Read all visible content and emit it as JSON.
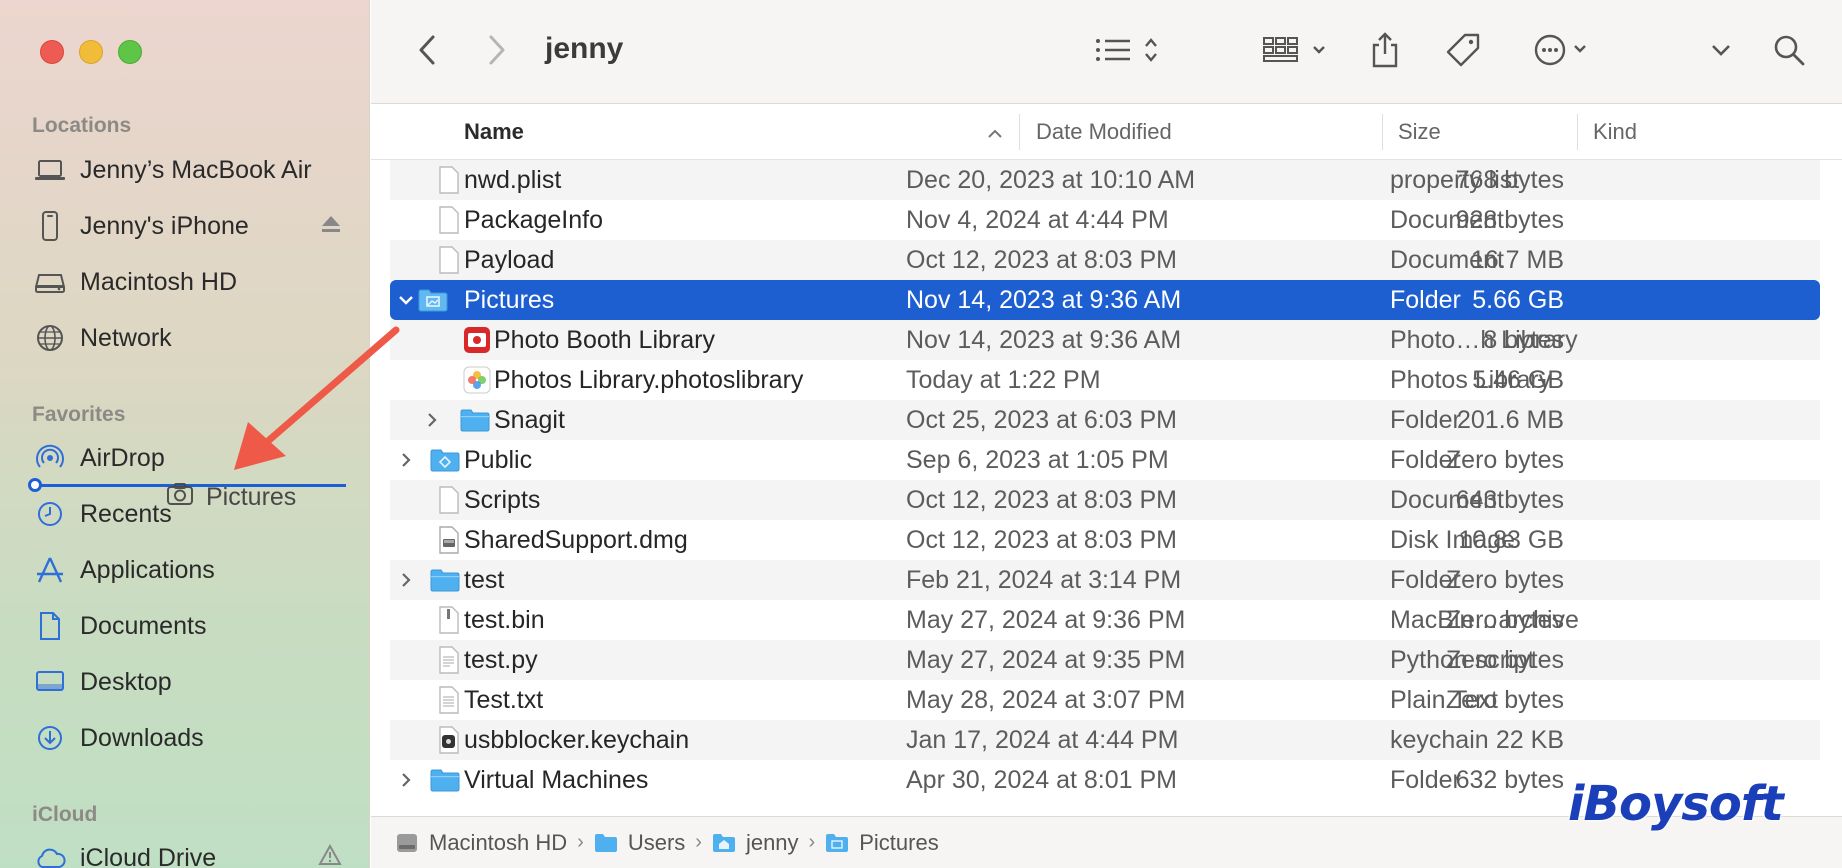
{
  "window": {
    "title": "jenny"
  },
  "sidebar": {
    "sections": [
      {
        "title": "Locations",
        "items": [
          {
            "label": "Jenny’s MacBook Air",
            "icon": "laptop-icon"
          },
          {
            "label": "Jenny's iPhone",
            "icon": "iphone-icon",
            "eject": true
          },
          {
            "label": "Macintosh HD",
            "icon": "disk-icon"
          },
          {
            "label": "Network",
            "icon": "globe-icon"
          }
        ]
      },
      {
        "title": "Favorites",
        "items": [
          {
            "label": "AirDrop",
            "icon": "airdrop-icon"
          },
          {
            "label": "Recents",
            "icon": "clock-icon"
          },
          {
            "label": "Applications",
            "icon": "applications-icon"
          },
          {
            "label": "Documents",
            "icon": "document-icon"
          },
          {
            "label": "Desktop",
            "icon": "desktop-icon"
          },
          {
            "label": "Downloads",
            "icon": "download-icon"
          }
        ]
      },
      {
        "title": "iCloud",
        "items": [
          {
            "label": "iCloud Drive",
            "icon": "cloud-icon",
            "warning": true
          }
        ]
      }
    ],
    "drag_ghost": {
      "label": "Pictures",
      "icon": "camera-icon"
    }
  },
  "columns": {
    "name": "Name",
    "date": "Date Modified",
    "size": "Size",
    "kind": "Kind"
  },
  "files": [
    {
      "name": "nwd.plist",
      "date": "Dec 20, 2023 at 10:10 AM",
      "size": "768 bytes",
      "kind": "property list",
      "icon": "file-icon"
    },
    {
      "name": "PackageInfo",
      "date": "Nov 4, 2024 at 4:44 PM",
      "size": "928 bytes",
      "kind": "Document",
      "icon": "file-icon"
    },
    {
      "name": "Payload",
      "date": "Oct 12, 2023 at 8:03 PM",
      "size": "16.7 MB",
      "kind": "Document",
      "icon": "file-icon"
    },
    {
      "name": "Pictures",
      "date": "Nov 14, 2023 at 9:36 AM",
      "size": "5.66 GB",
      "kind": "Folder",
      "icon": "pictures-folder-icon",
      "selected": true,
      "expanded": true
    },
    {
      "name": "Photo Booth Library",
      "date": "Nov 14, 2023 at 9:36 AM",
      "size": "8 bytes",
      "kind": "Photo…h Library",
      "icon": "photo-booth-icon",
      "indent": 1
    },
    {
      "name": "Photos Library.photoslibrary",
      "date": "Today at 1:22 PM",
      "size": "5.46 GB",
      "kind": "Photos Library",
      "icon": "photos-library-icon",
      "indent": 1
    },
    {
      "name": "Snagit",
      "date": "Oct 25, 2023 at 6:03 PM",
      "size": "201.6 MB",
      "kind": "Folder",
      "icon": "folder-icon",
      "indent": 1,
      "collapsed": true
    },
    {
      "name": "Public",
      "date": "Sep 6, 2023 at 1:05 PM",
      "size": "Zero bytes",
      "kind": "Folder",
      "icon": "public-folder-icon",
      "collapsed": true
    },
    {
      "name": "Scripts",
      "date": "Oct 12, 2023 at 8:03 PM",
      "size": "643 bytes",
      "kind": "Document",
      "icon": "file-icon"
    },
    {
      "name": "SharedSupport.dmg",
      "date": "Oct 12, 2023 at 8:03 PM",
      "size": "10.83 GB",
      "kind": "Disk Image",
      "icon": "dmg-icon"
    },
    {
      "name": "test",
      "date": "Feb 21, 2024 at 3:14 PM",
      "size": "Zero bytes",
      "kind": "Folder",
      "icon": "folder-icon",
      "collapsed": true
    },
    {
      "name": "test.bin",
      "date": "May 27, 2024 at 9:36 PM",
      "size": "Zero bytes",
      "kind": "MacBin…archive",
      "icon": "bin-icon"
    },
    {
      "name": "test.py",
      "date": "May 27, 2024 at 9:35 PM",
      "size": "Zero bytes",
      "kind": "Python script",
      "icon": "script-icon"
    },
    {
      "name": "Test.txt",
      "date": "May 28, 2024 at 3:07 PM",
      "size": "Zero bytes",
      "kind": "Plain Text",
      "icon": "text-file-icon"
    },
    {
      "name": "usbblocker.keychain",
      "date": "Jan 17, 2024 at 4:44 PM",
      "size": "22 KB",
      "kind": "keychain",
      "icon": "keychain-icon"
    },
    {
      "name": "Virtual Machines",
      "date": "Apr 30, 2024 at 8:01 PM",
      "size": "632 bytes",
      "kind": "Folder",
      "icon": "folder-icon",
      "collapsed": true
    }
  ],
  "pathbar": [
    "Macintosh HD",
    "Users",
    "jenny",
    "Pictures"
  ],
  "watermark": "iBoysoft",
  "colors": {
    "selection": "#1d5fd1",
    "folder": "#3aa6ee",
    "drop_indicator": "#1f5fd4",
    "arrow": "#ee5a47"
  }
}
